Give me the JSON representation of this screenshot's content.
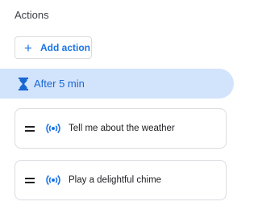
{
  "section": {
    "title": "Actions"
  },
  "add_action": {
    "icon": "plus-icon",
    "label": "Add action"
  },
  "delay": {
    "icon": "hourglass-icon",
    "label": "After 5 min"
  },
  "actions": [
    {
      "handle_icon": "drag-handle-icon",
      "icon": "broadcast-icon",
      "label": "Tell me about the weather"
    },
    {
      "handle_icon": "drag-handle-icon",
      "icon": "broadcast-icon",
      "label": "Play a delightful chime"
    }
  ],
  "colors": {
    "accent": "#1a73e8",
    "highlight_bg": "#d2e3fc",
    "highlight_text": "#1967d2",
    "border": "#dadce0",
    "text": "#202124"
  }
}
